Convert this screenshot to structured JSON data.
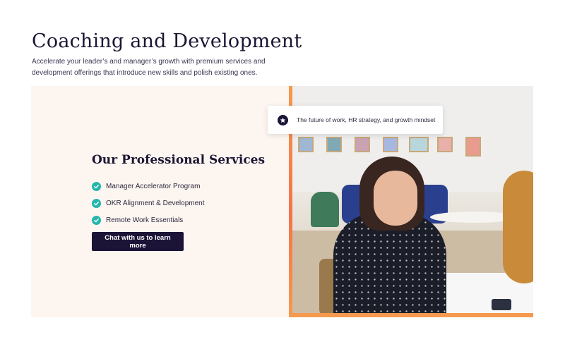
{
  "header": {
    "title": "Coaching and Development",
    "subtitle": "Accelerate your leader’s and manager’s growth with premium services and development offerings that introduce new skills and polish existing ones."
  },
  "services": {
    "title": "Our Professional Services",
    "items": [
      {
        "label": "Manager Accelerator Program",
        "icon": "check-circle-icon"
      },
      {
        "label": "OKR Alignment & Development",
        "icon": "check-circle-icon"
      },
      {
        "label": "Remote Work Essentials",
        "icon": "check-circle-icon"
      }
    ],
    "cta_label": "Chat with us to learn more"
  },
  "badge": {
    "icon": "star-icon",
    "text": "The future of work, HR strategy, and growth mindset"
  },
  "colors": {
    "accent_teal": "#25b5ad",
    "navy": "#1c1436",
    "panel_bg": "#fdf5f0",
    "orange_border": "#f3734a"
  }
}
